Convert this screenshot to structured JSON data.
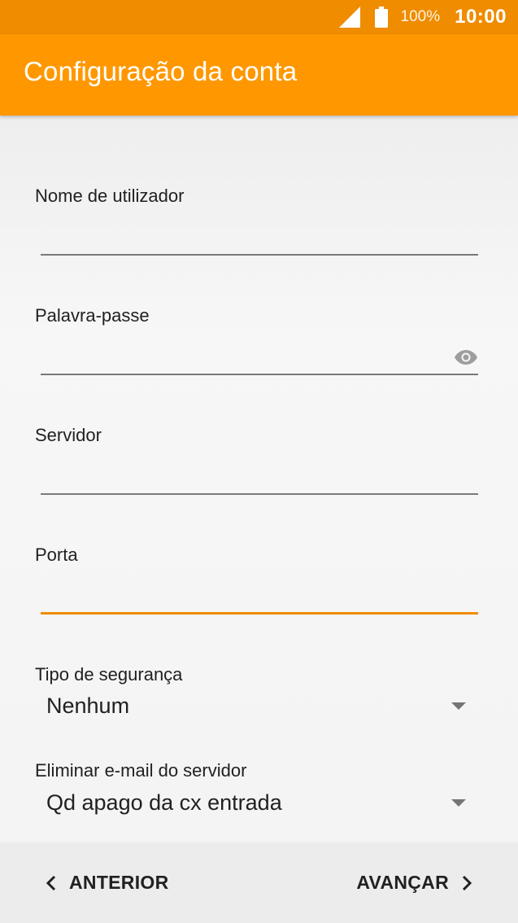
{
  "status_bar": {
    "battery_text": "100%",
    "time": "10:00",
    "icons": [
      "signal-icon",
      "battery-icon"
    ]
  },
  "app_bar": {
    "title": "Configuração da conta"
  },
  "form": {
    "username": {
      "label": "Nome de utilizador",
      "value": ""
    },
    "password": {
      "label": "Palavra-passe",
      "value": "",
      "toggle_icon": "eye-icon"
    },
    "server": {
      "label": "Servidor",
      "value": ""
    },
    "port": {
      "label": "Porta",
      "value": ""
    },
    "security_type": {
      "label": "Tipo de segurança",
      "selected": "Nenhum"
    },
    "delete_email": {
      "label": "Eliminar e-mail do servidor",
      "selected": "Qd apago da cx entrada"
    }
  },
  "navigation": {
    "previous_label": "ANTERIOR",
    "next_label": "AVANÇAR"
  },
  "colors": {
    "status_bar": "#ef8c00",
    "app_bar": "#ff9800",
    "accent": "#ef8c00",
    "text": "#212121"
  }
}
